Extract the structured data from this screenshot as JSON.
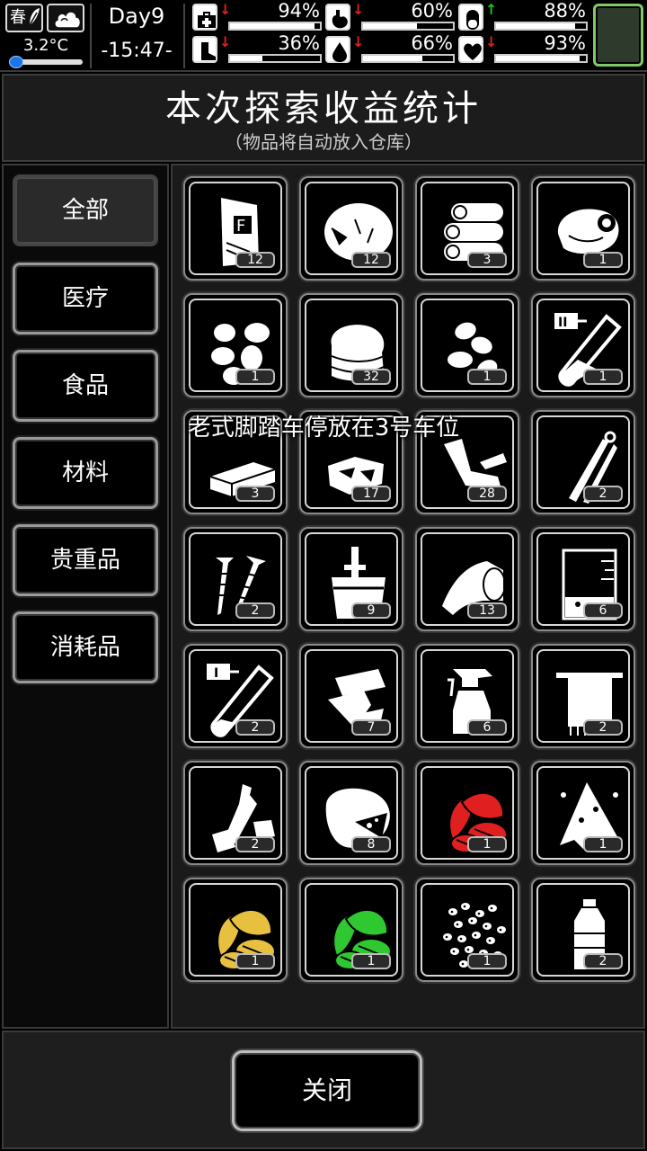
{
  "status": {
    "season": "春",
    "temperature": "3.2°C",
    "temperature_level": 0.05,
    "day": "Day9",
    "time": "-15:47-",
    "stats": [
      {
        "name": "health",
        "icon": "medkit-icon",
        "trend": "down",
        "value": "94%",
        "level": 0.94
      },
      {
        "name": "hunger",
        "icon": "stomach-icon",
        "trend": "down",
        "value": "60%",
        "level": 0.6
      },
      {
        "name": "medicine",
        "icon": "pill-icon",
        "trend": "up",
        "value": "88%",
        "level": 0.88
      },
      {
        "name": "stamina",
        "icon": "foot-icon",
        "trend": "down",
        "value": "36%",
        "level": 0.36
      },
      {
        "name": "thirst",
        "icon": "water-drop-icon",
        "trend": "down",
        "value": "66%",
        "level": 0.66
      },
      {
        "name": "mood",
        "icon": "heart-icon",
        "trend": "down",
        "value": "93%",
        "level": 0.93
      }
    ],
    "colors": {
      "down": "#e02020",
      "up": "#20c020",
      "temp_knob": "#1e73e8",
      "slot_border": "#7fc96a"
    }
  },
  "header": {
    "title": "本次探索收益统计",
    "subtitle": "（物品将自动放入仓库）"
  },
  "categories": [
    {
      "label": "全部",
      "active": true
    },
    {
      "label": "医疗",
      "active": false
    },
    {
      "label": "食品",
      "active": false
    },
    {
      "label": "材料",
      "active": false
    },
    {
      "label": "贵重品",
      "active": false
    },
    {
      "label": "消耗品",
      "active": false
    }
  ],
  "items": [
    {
      "icon": "flour-bag-icon",
      "count": "12"
    },
    {
      "icon": "cotton-icon",
      "count": "12"
    },
    {
      "icon": "cloth-roll-icon",
      "count": "3"
    },
    {
      "icon": "meat-icon",
      "count": "1"
    },
    {
      "icon": "potato-icon",
      "count": "1"
    },
    {
      "icon": "folded-fabric-icon",
      "count": "32"
    },
    {
      "icon": "seeds-icon",
      "count": "1"
    },
    {
      "icon": "test-tube-ii-icon",
      "count": "1"
    },
    {
      "icon": "metal-bar-icon",
      "count": "3"
    },
    {
      "icon": "glass-shards-icon",
      "count": "17"
    },
    {
      "icon": "pipe-scraps-icon",
      "count": "28"
    },
    {
      "icon": "tweezers-icon",
      "count": "2"
    },
    {
      "icon": "screws-icon",
      "count": "2"
    },
    {
      "icon": "bucket-icon",
      "count": "9"
    },
    {
      "icon": "bandage-roll-icon",
      "count": "13"
    },
    {
      "icon": "beaker-icon",
      "count": "6"
    },
    {
      "icon": "test-tube-i-icon",
      "count": "2"
    },
    {
      "icon": "paper-scraps-icon",
      "count": "7"
    },
    {
      "icon": "spray-bottle-icon",
      "count": "6"
    },
    {
      "icon": "towel-icon",
      "count": "2"
    },
    {
      "icon": "plastic-trash-icon",
      "count": "2"
    },
    {
      "icon": "sack-icon",
      "count": "8"
    },
    {
      "icon": "red-herb-icon",
      "count": "1"
    },
    {
      "icon": "torn-cloth-icon",
      "count": "1"
    },
    {
      "icon": "yellow-herb-icon",
      "count": "1"
    },
    {
      "icon": "green-herb-icon",
      "count": "1"
    },
    {
      "icon": "beans-icon",
      "count": "1"
    },
    {
      "icon": "water-bottle-icon",
      "count": "2"
    }
  ],
  "item_colors": {
    "red_herb": "#e02020",
    "yellow_herb": "#e8c040",
    "green_herb": "#30c830"
  },
  "toast": "老式脚踏车停放在3号车位",
  "close_button": "关闭"
}
